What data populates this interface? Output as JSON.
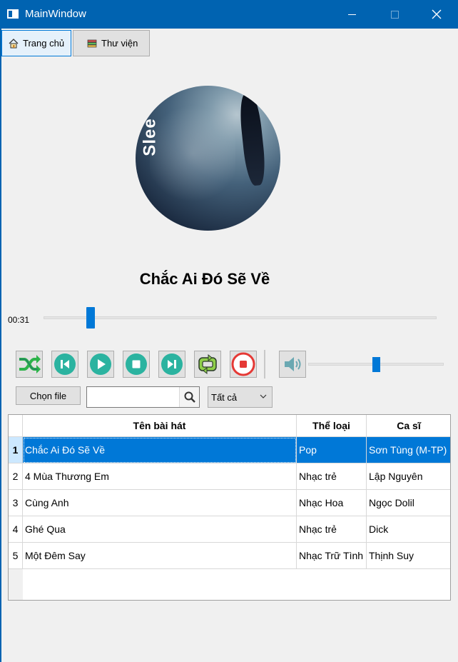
{
  "window": {
    "title": "MainWindow"
  },
  "tabs": [
    {
      "label": "Trang chủ",
      "icon": "home-icon",
      "active": true
    },
    {
      "label": "Thư viện",
      "icon": "library-icon",
      "active": false
    }
  ],
  "now_playing": {
    "album_art_text": "Slee",
    "title": "Chắc Ai Đó Sẽ Về",
    "current_time": "00:31",
    "progress_fraction": 0.12
  },
  "controls": {
    "buttons": [
      "shuffle-icon",
      "previous-icon",
      "play-icon",
      "stop-icon",
      "next-icon",
      "repeat-icon",
      "record-icon"
    ],
    "volume_fraction": 0.5
  },
  "toolbar": {
    "choose_file_label": "Chọn file",
    "search_placeholder": "",
    "filter_selected": "Tất cả"
  },
  "table": {
    "columns": [
      "Tên bài hát",
      "Thể loại",
      "Ca sĩ"
    ],
    "rows": [
      {
        "num": "1",
        "title": "Chắc Ai Đó Sẽ Về",
        "genre": "Pop",
        "artist": "Sơn Tùng (M-TP)"
      },
      {
        "num": "2",
        "title": "4 Mùa Thương Em",
        "genre": "Nhạc trẻ",
        "artist": "Lập Nguyên"
      },
      {
        "num": "3",
        "title": "Cùng Anh",
        "genre": "Nhạc Hoa",
        "artist": "Ngọc Dolil"
      },
      {
        "num": "4",
        "title": "Ghé Qua",
        "genre": "Nhạc trẻ",
        "artist": "Dick"
      },
      {
        "num": "5",
        "title": "Một Đêm Say",
        "genre": "Nhạc Trữ Tình",
        "artist": "Thịnh Suy"
      }
    ],
    "selected_row": 0
  },
  "colors": {
    "titlebar": "#0063b1",
    "accent": "#0078d7",
    "selection_text": "#ffffff"
  }
}
